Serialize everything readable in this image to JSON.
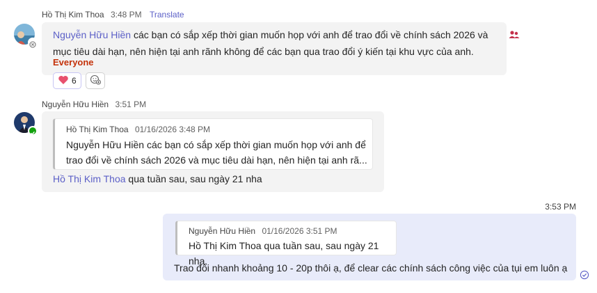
{
  "messages": [
    {
      "sender": "Hồ Thị Kim Thoa",
      "time": "3:48 PM",
      "translate": "Translate",
      "mention": "Nguyễn Hữu Hiền",
      "text_line1": " các bạn có sắp xếp thời gian muốn họp với anh để trao đổi về chính sách 2026 và",
      "text_line2": "mục tiêu dài hạn, nên hiện tại anh rãnh không để các bạn qua trao đổi ý kiến tại khu vực của anh.",
      "everyone": "Everyone",
      "reaction_count": "6"
    },
    {
      "sender": "Nguyễn Hữu Hiền",
      "time": "3:51 PM",
      "quote": {
        "author": "Hồ Thị Kim Thoa",
        "date": "01/16/2026 3:48 PM",
        "line1": "Nguyễn Hữu Hiền các bạn có sắp xếp thời gian muốn họp với anh để",
        "line2": "trao đổi về chính sách 2026 và mục tiêu dài hạn, nên hiện tại anh rã..."
      },
      "mention": "Hồ Thị Kim Thoa",
      "text": " qua tuần sau, sau ngày 21 nha"
    },
    {
      "time": "3:53 PM",
      "quote": {
        "author": "Nguyễn Hữu Hiền",
        "date": "01/16/2026 3:51 PM",
        "line1": "Hồ Thị Kim Thoa qua tuần sau, sau ngày 21 nha"
      },
      "text": "Trao đổi nhanh khoảng 10 - 20p thôi ạ, để clear các chính sách công việc của tụi em luôn ạ"
    }
  ],
  "colors": {
    "accent": "#5b5fc7",
    "everyone": "#c4320a",
    "bubble": "#f3f3f3",
    "sent_bubble": "#e8ebfa"
  }
}
